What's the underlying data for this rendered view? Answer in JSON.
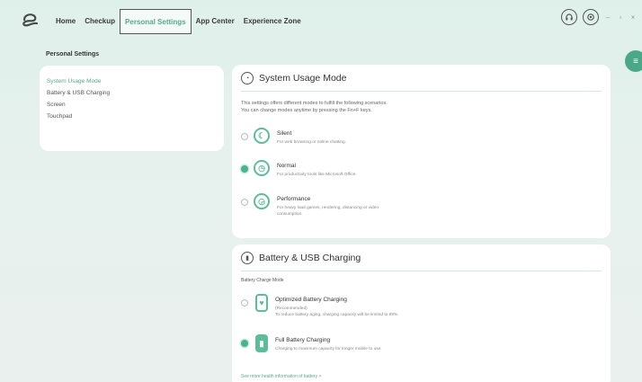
{
  "app": {
    "logo_icon": "app-logo-icon",
    "accent": "#49b38d"
  },
  "nav": {
    "items": [
      {
        "label": "Home"
      },
      {
        "label": "Checkup"
      },
      {
        "label": "Personal Settings"
      },
      {
        "label": "App Center"
      },
      {
        "label": "Experience Zone"
      }
    ],
    "active_index": 2
  },
  "window_controls": {
    "minimize": "–",
    "maximize": "▫",
    "close": "×"
  },
  "page": {
    "title": "Personal Settings"
  },
  "sidebar": {
    "items": [
      {
        "label": "System Usage Mode"
      },
      {
        "label": "Battery & USB Charging"
      },
      {
        "label": "Screen"
      },
      {
        "label": "Touchpad"
      }
    ],
    "active_index": 0
  },
  "usage_mode": {
    "title": "System Usage Mode",
    "description_line1": "This settings offers different modes to fulfill the following scenarios.",
    "description_line2": "You can change modes anytime by pressing the Fn+F keys.",
    "options": [
      {
        "title": "Silent",
        "subtitle": "For web browsing or online chatting.",
        "selected": false
      },
      {
        "title": "Normal",
        "subtitle": "For productivity tools like Microsoft Office.",
        "selected": true
      },
      {
        "title": "Performance",
        "subtitle_line1": "For heavy load games, rendering, distancing or video",
        "subtitle_line2": "consumption.",
        "selected": false
      }
    ]
  },
  "battery": {
    "title": "Battery & USB Charging",
    "mode_label": "Battery Charge Mode",
    "options": [
      {
        "title": "Optimized Battery Charging",
        "subtitle_line1": "(Recommended)",
        "subtitle_line2": "To reduce battery aging, charging capacity will be limited to 89%.",
        "selected": false
      },
      {
        "title": "Full Battery Charging",
        "subtitle": "Charging to maximum capacity for longer mobile to use.",
        "selected": true
      }
    ],
    "more_link": "See more health information of battery >"
  }
}
